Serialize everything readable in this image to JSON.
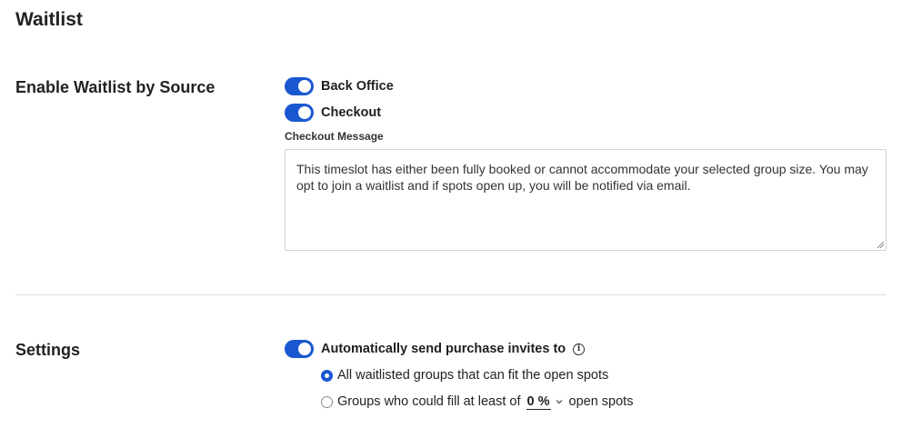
{
  "page": {
    "title": "Waitlist"
  },
  "sources": {
    "label": "Enable Waitlist by Source",
    "toggles": [
      {
        "label": "Back Office",
        "on": true
      },
      {
        "label": "Checkout",
        "on": true
      }
    ],
    "message_label": "Checkout Message",
    "message_value": "This timeslot has either been fully booked or cannot accommodate your selected group size. You may opt to join a waitlist and if spots open up, you will be notified via email."
  },
  "settings": {
    "label": "Settings",
    "auto_invite": {
      "label": "Automatically send purchase invites to",
      "on": true
    },
    "options": [
      {
        "label": "All waitlisted groups that can fit the open spots",
        "selected": true
      },
      {
        "label_before": "Groups who could fill at least of",
        "percent": "0 %",
        "label_after": "open spots",
        "selected": false
      }
    ]
  },
  "colors": {
    "accent": "#1957d1"
  },
  "icons": {
    "info": "info-icon",
    "chevron": "chevron-down-icon",
    "resize": "resize-grip-icon"
  }
}
